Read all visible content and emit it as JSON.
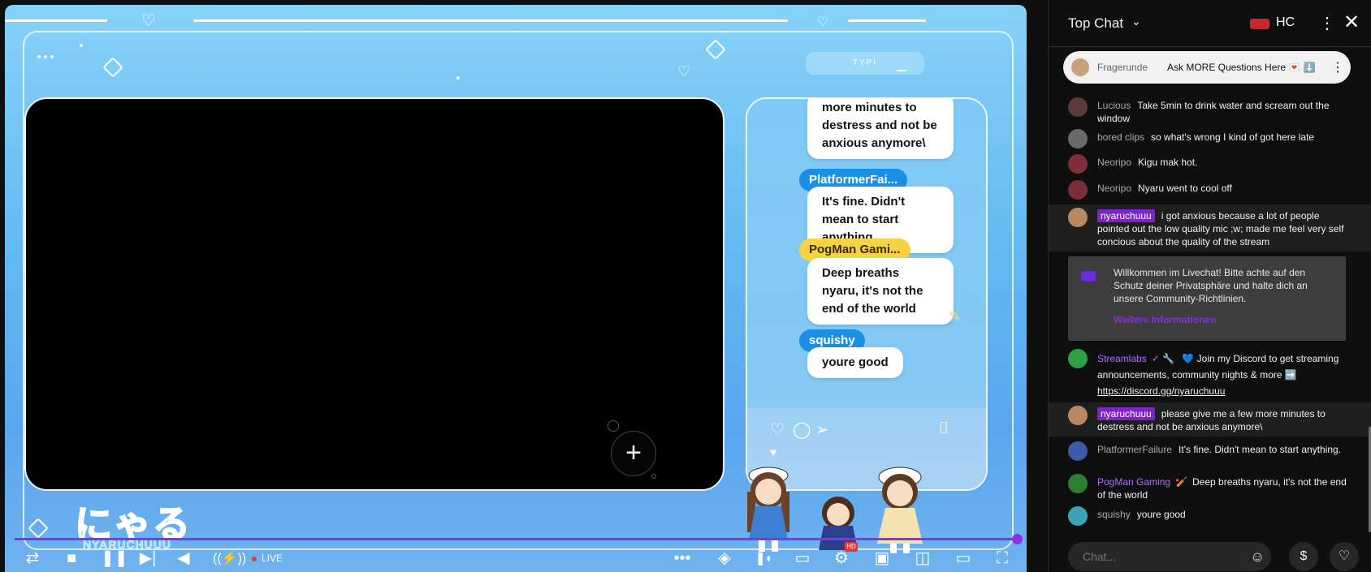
{
  "overlay": {
    "tag": "TYPI",
    "messages": [
      {
        "name": "",
        "text": "more minutes to destress and not be anxious anymore\\"
      },
      {
        "name": "PlatformerFai...",
        "text": "It's fine. Didn't mean to start anything."
      },
      {
        "name": "PogMan Gami...",
        "text": "Deep breaths nyaru, it's not the end of the world"
      },
      {
        "name": "squishy",
        "text": "youre good"
      }
    ],
    "logo": "にゃる",
    "logo_sub": "NYARUCHUUU"
  },
  "player": {
    "progress": 1.0,
    "live_label": "LIVE",
    "add_label": "+",
    "hd_badge": "HD"
  },
  "chat": {
    "title": "Top Chat",
    "hc_label": "HC",
    "pinned": {
      "author": "Fragerunde",
      "text": "Ask MORE Questions Here 💌 ⬇️"
    },
    "messages": [
      {
        "author": "Lucious",
        "text": "Take 5min to drink water and scream out the window",
        "avatar_color": "#5a3b3b"
      },
      {
        "author": "bored clips",
        "text": "so what's wrong I kind of got here late",
        "avatar_color": "#6a6a6a"
      },
      {
        "author": "Neoripo",
        "text": "Kigu mak hot.",
        "avatar_color": "#7a2f3a"
      },
      {
        "author": "Neoripo",
        "text": "Nyaru went to cool off",
        "avatar_color": "#7a2f3a"
      },
      {
        "author": "nyaruchuuu",
        "text": "i got anxious because a lot of people pointed out the low quality mic ;w; made me feel very self concious about the quality of the stream",
        "avatar_color": "#b88a63",
        "owner": true
      },
      {
        "author": "Streamlabs",
        "badges": "✓ 🔧",
        "text": "💙 Join my Discord to get streaming announcements, community nights & more ➡️",
        "link": "https://discord.gg/nyaruchuuu",
        "avatar_color": "#2ea043"
      },
      {
        "author": "nyaruchuuu",
        "text": "please give me a few more minutes to destress and not be anxious anymore\\",
        "avatar_color": "#b88a63",
        "owner": true
      },
      {
        "author": "PlatformerFailure",
        "text": "It's fine. Didn't mean to start anything.",
        "avatar_color": "#3c5aa6"
      },
      {
        "author": "PogMan Gaming",
        "badges": "🏏",
        "text": "Deep breaths nyaru, it's not the end of the world",
        "avatar_color": "#2e7d32"
      },
      {
        "author": "squishy",
        "text": "youre good",
        "avatar_color": "#3aa3b4"
      }
    ],
    "notice": {
      "text": "Willkommen im Livechat! Bitte achte auf den Schutz deiner Privatsphäre und halte dich an unsere Community-Richtlinien.",
      "more": "Weitere Informationen"
    },
    "input_placeholder": "Chat..."
  }
}
